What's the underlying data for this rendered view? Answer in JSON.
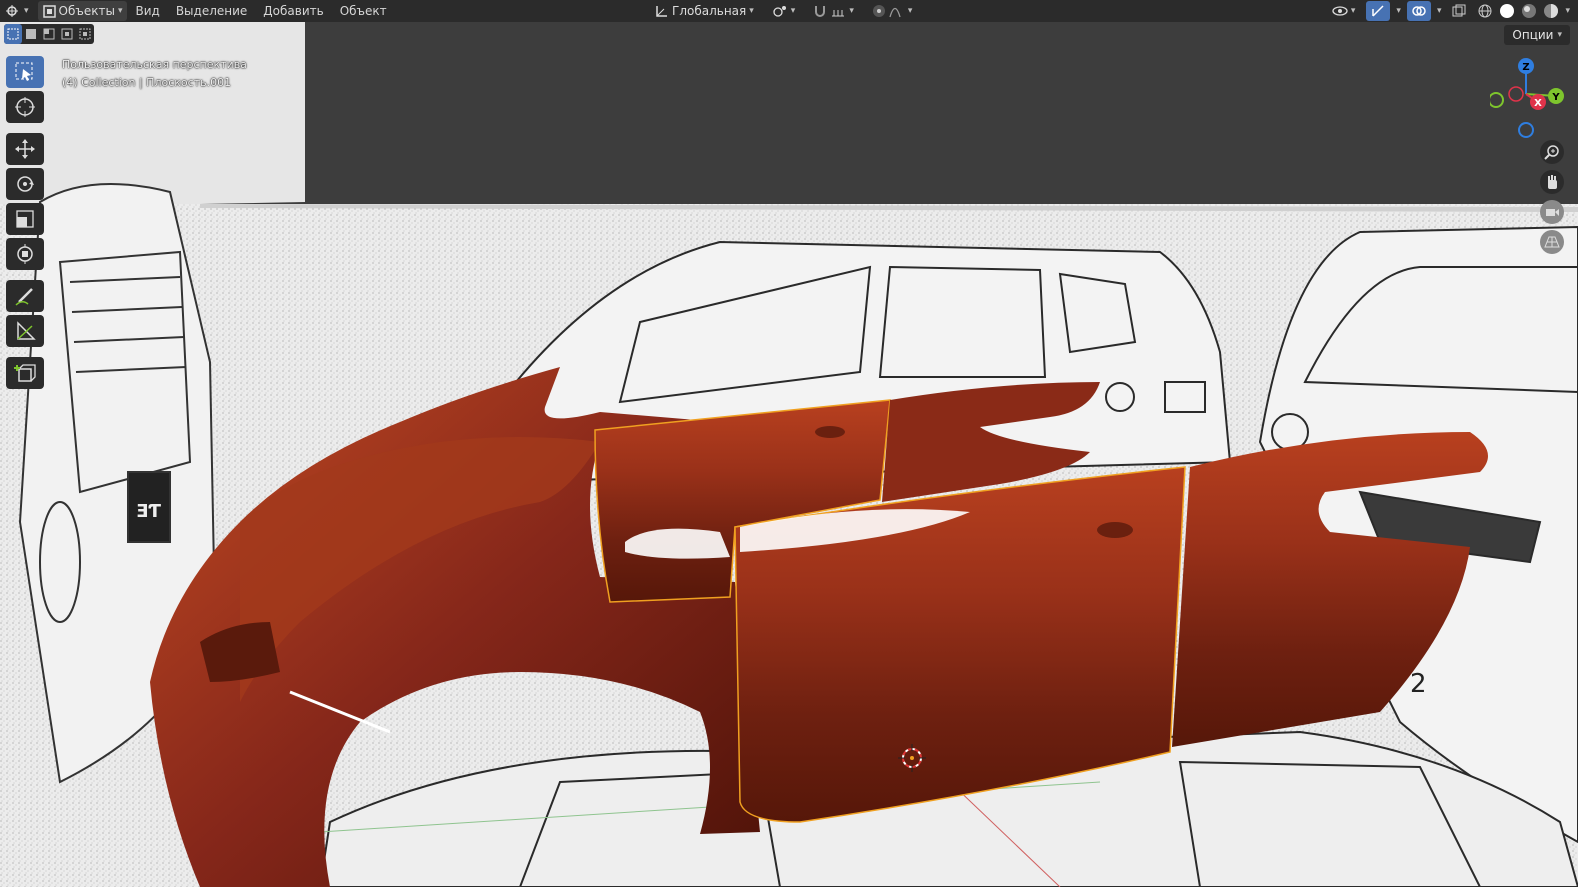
{
  "header": {
    "mode_label": "Объекты",
    "menu": [
      "Вид",
      "Выделение",
      "Добавить",
      "Объект"
    ],
    "orientation_label": "Глобальная"
  },
  "options_label": "Опции",
  "overlay": {
    "view_name": "Пользовательская перспектива",
    "collection_line": "(4) Collection | Плоскость.001"
  },
  "gizmo": {
    "z": "Z",
    "y": "Y",
    "x": "X"
  },
  "reference_digit": "2",
  "colors": {
    "accent": "#4772b3",
    "body_paint": "#8a2a17",
    "selection_outline": "#f0a020",
    "axis_x": "#e0334a",
    "axis_y": "#7ec52d",
    "axis_z": "#2f7ee0"
  }
}
